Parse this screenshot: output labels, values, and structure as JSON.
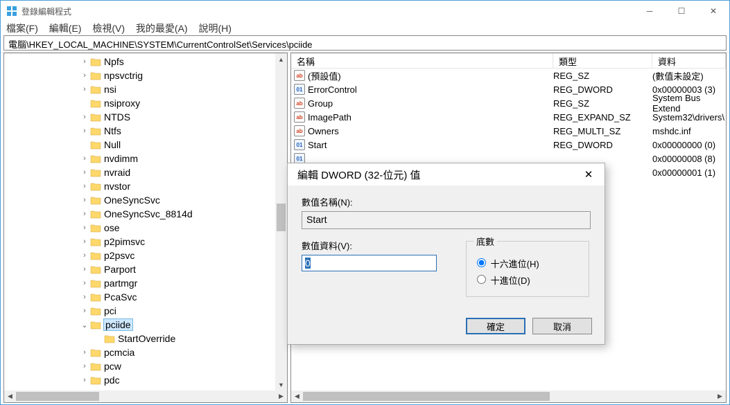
{
  "window": {
    "title": "登錄編輯程式",
    "path": "電腦\\HKEY_LOCAL_MACHINE\\SYSTEM\\CurrentControlSet\\Services\\pciide"
  },
  "menu": {
    "file": "檔案(F)",
    "edit": "編輯(E)",
    "view": "檢視(V)",
    "fav": "我的最愛(A)",
    "help": "說明(H)"
  },
  "tree": [
    {
      "name": "Npfs",
      "exp": true
    },
    {
      "name": "npsvctrig",
      "exp": true
    },
    {
      "name": "nsi",
      "exp": true
    },
    {
      "name": "nsiproxy",
      "exp": false
    },
    {
      "name": "NTDS",
      "exp": true
    },
    {
      "name": "Ntfs",
      "exp": true
    },
    {
      "name": "Null",
      "exp": false
    },
    {
      "name": "nvdimm",
      "exp": true
    },
    {
      "name": "nvraid",
      "exp": true
    },
    {
      "name": "nvstor",
      "exp": true
    },
    {
      "name": "OneSyncSvc",
      "exp": true
    },
    {
      "name": "OneSyncSvc_8814d",
      "exp": true
    },
    {
      "name": "ose",
      "exp": true
    },
    {
      "name": "p2pimsvc",
      "exp": true
    },
    {
      "name": "p2psvc",
      "exp": true
    },
    {
      "name": "Parport",
      "exp": true
    },
    {
      "name": "partmgr",
      "exp": true
    },
    {
      "name": "PcaSvc",
      "exp": true
    },
    {
      "name": "pci",
      "exp": true
    },
    {
      "name": "pciide",
      "exp": true,
      "open": true,
      "selected": true
    },
    {
      "name": "StartOverride",
      "exp": false,
      "child": true
    },
    {
      "name": "pcmcia",
      "exp": true
    },
    {
      "name": "pcw",
      "exp": true
    },
    {
      "name": "pdc",
      "exp": true
    }
  ],
  "list": {
    "headers": {
      "name": "名稱",
      "type": "類型",
      "data": "資料"
    },
    "rows": [
      {
        "icon": "str",
        "name": "(預設值)",
        "type": "REG_SZ",
        "data": "(數值未設定)"
      },
      {
        "icon": "bin",
        "name": "ErrorControl",
        "type": "REG_DWORD",
        "data": "0x00000003 (3)"
      },
      {
        "icon": "str",
        "name": "Group",
        "type": "REG_SZ",
        "data": "System Bus Extend"
      },
      {
        "icon": "str",
        "name": "ImagePath",
        "type": "REG_EXPAND_SZ",
        "data": "System32\\drivers\\"
      },
      {
        "icon": "str",
        "name": "Owners",
        "type": "REG_MULTI_SZ",
        "data": "mshdc.inf"
      },
      {
        "icon": "bin",
        "name": "Start",
        "type": "REG_DWORD",
        "data": "0x00000000 (0)"
      },
      {
        "icon": "bin",
        "name": "",
        "type": "",
        "data": "0x00000008 (8)"
      },
      {
        "icon": "bin",
        "name": "",
        "type": "",
        "data": "0x00000001 (1)"
      }
    ]
  },
  "dialog": {
    "title": "編輯 DWORD (32-位元) 值",
    "name_label": "數值名稱(N):",
    "name_value": "Start",
    "data_label": "數值資料(V):",
    "data_value": "0",
    "base_label": "底數",
    "hex_label": "十六進位(H)",
    "dec_label": "十進位(D)",
    "ok": "確定",
    "cancel": "取消"
  }
}
